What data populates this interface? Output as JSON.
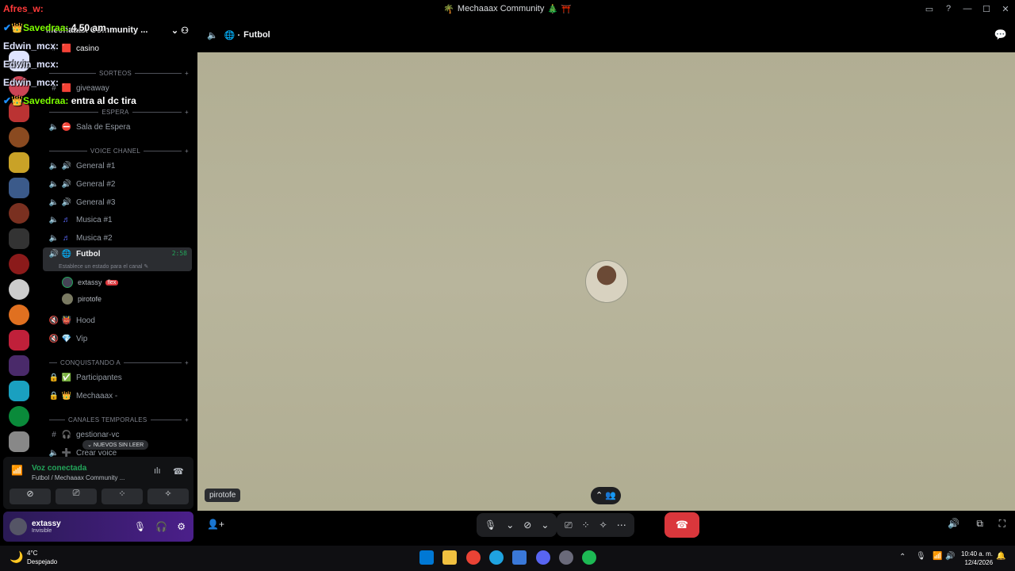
{
  "window": {
    "title": "Mechaaax Community",
    "title_icons": [
      "🌴",
      "🎄",
      "⛩️"
    ]
  },
  "overlay_chat": [
    {
      "user": "Afres_w:",
      "text": "",
      "color": "#ff3a3a"
    },
    {
      "user": "Savedraa:",
      "text": "4.50 am",
      "color": "#7cfc00"
    },
    {
      "user": "Edwin_mcx:",
      "text": "",
      "color": "#dfe4ff"
    },
    {
      "user": "Edwin_mcx:",
      "text": "",
      "color": "#dfe4ff"
    },
    {
      "user": "Edwin_mcx:",
      "text": "",
      "color": "#dfe4ff"
    },
    {
      "user": "Savedraa:",
      "text": "entra al dc tira",
      "color": "#7cfc00"
    }
  ],
  "server": {
    "name": "Mechaaax Community ..."
  },
  "channels": {
    "casino": "casino",
    "cat_sorteos": "SORTEOS",
    "giveaway": "giveaway",
    "cat_espera": "ESPERA",
    "sala_espera": "Sala de Espera",
    "cat_voice": "VOICE CHANEL",
    "general1": "General #1",
    "general2": "General #2",
    "general3": "General #3",
    "musica1": "Musica #1",
    "musica2": "Musica #2",
    "futbol": "Futbol",
    "futbol_time": "2:58",
    "futbol_status": "Establece un estado para el canal",
    "member1": "extassy",
    "member1_tag": "flex",
    "member2": "pirotofe",
    "hood": "Hood",
    "vip": "Vip",
    "cat_conquistando": "CONQUISTANDO A",
    "participantes": "Participantes",
    "mechaaax": "Mechaaax -",
    "cat_temporales": "CANALES TEMPORALES",
    "gestionar": "gestionar-vc",
    "crear": "Crear voice",
    "unread_pill": "NUEVOS SIN LEER"
  },
  "voice_panel": {
    "status": "Voz conectada",
    "location": "Futbol / Mechaaax Community ..."
  },
  "user_panel": {
    "name": "extassy",
    "status": "Invisible"
  },
  "stage": {
    "channel": "Futbol",
    "tile_name": "pirotofe"
  },
  "weather": {
    "temp": "4°C",
    "desc": "Despejado"
  },
  "clock": {
    "time": "10:40 a. m.",
    "date": "12/4/2026"
  }
}
